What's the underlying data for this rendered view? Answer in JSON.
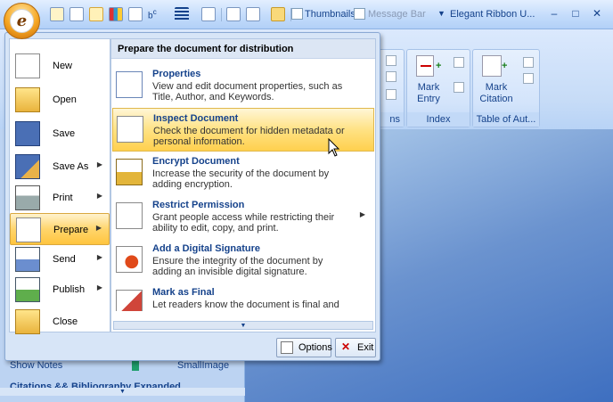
{
  "quick_access": {
    "thumbnails_label": "Thumbnails",
    "message_bar_label": "Message Bar",
    "app_title": "Elegant Ribbon U...",
    "minimize": "–",
    "restore": "□",
    "close": "✕"
  },
  "orb": {
    "letter": "e"
  },
  "ribbon_behind": {
    "groups": [
      {
        "label": "ns"
      },
      {
        "label": "Index",
        "button": "Mark Entry"
      },
      {
        "label": "Table of Aut...",
        "button": "Mark Citation"
      }
    ]
  },
  "left_pane": {
    "show_notes": "Show Notes",
    "small_image": "SmallImage",
    "citations": "Citations && Bibliography Expanded"
  },
  "menu": {
    "left_items": [
      {
        "label": "New",
        "arrow": ""
      },
      {
        "label": "Open",
        "arrow": ""
      },
      {
        "label": "Save",
        "arrow": ""
      },
      {
        "label": "Save As",
        "arrow": "▶"
      },
      {
        "label": "Print",
        "arrow": "▶"
      },
      {
        "label": "Prepare",
        "arrow": "▶"
      },
      {
        "label": "Send",
        "arrow": "▶"
      },
      {
        "label": "Publish",
        "arrow": "▶"
      },
      {
        "label": "Close",
        "arrow": ""
      }
    ],
    "submenu_title": "Prepare the document for distribution",
    "submenu_items": [
      {
        "title": "Properties",
        "desc": "View and edit document properties, such as Title, Author, and Keywords."
      },
      {
        "title": "Inspect Document",
        "desc": "Check the document for hidden metadata or personal information."
      },
      {
        "title": "Encrypt Document",
        "desc": "Increase the security of the document by adding encryption."
      },
      {
        "title": "Restrict Permission",
        "desc": "Grant people access while restricting their ability to edit, copy, and print."
      },
      {
        "title": "Add a Digital Signature",
        "desc": "Ensure the integrity of the document by adding an invisible digital signature."
      },
      {
        "title": "Mark as Final",
        "desc": "Let readers know the document is final and"
      }
    ],
    "options_label": "Options",
    "exit_label": "Exit"
  },
  "colors": {
    "accent": "#ffd56c",
    "ribbon_text": "#15428b"
  }
}
